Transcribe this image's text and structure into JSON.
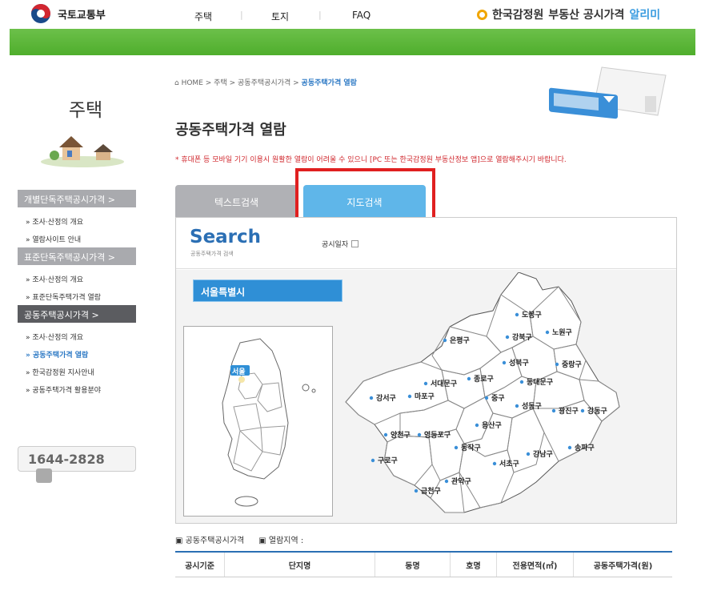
{
  "header": {
    "logo_text": "국토교통부",
    "nav": [
      "주택",
      "토지",
      "FAQ"
    ],
    "brand": "한국감정원",
    "brand_suffix": "부동산 공시가격",
    "brand_accent": "알리미"
  },
  "sidebar": {
    "title": "주택",
    "sections": [
      {
        "label": "개별단독주택공시가격 >",
        "items": [
          "» 조사·산정의 개요",
          "» 열람사이트 안내"
        ]
      },
      {
        "label": "표준단독주택공시가격 >",
        "items": [
          "» 조사·산정의 개요",
          "» 표준단독주택가격 열람"
        ]
      },
      {
        "label": "공동주택공시가격 >",
        "items": [
          "» 조사·산정의 개요",
          "» 공동주택가격 열람",
          "» 한국감정원 지사안내",
          "» 공동주택가격 활용분야"
        ]
      }
    ],
    "phone": "1644-2828"
  },
  "breadcrumb": [
    "HOME",
    "주택",
    "공동주택공시가격",
    "공동주택가격 열람"
  ],
  "page_title": "공동주택가격 열람",
  "notice": "* 휴대폰 등 모바일 기기 이용시 원활한 열람이 어려울 수 있으니 [PC 또는 한국감정원 부동산정보 앱]으로 열람해주시기 바랍니다.",
  "tabs": [
    "텍스트검색",
    "지도검색"
  ],
  "search": {
    "title": "Search",
    "subtitle": "공동주택가격 검색",
    "date_label": "공시일자"
  },
  "map": {
    "city": "서울특별시",
    "korea_label": "서울",
    "districts": [
      "도봉구",
      "노원구",
      "강북구",
      "은평구",
      "성북구",
      "중랑구",
      "종로구",
      "동대문구",
      "서대문구",
      "강서구",
      "마포구",
      "중구",
      "성동구",
      "광진구",
      "강동구",
      "용산구",
      "양천구",
      "영등포구",
      "동작구",
      "강남구",
      "송파구",
      "구로구",
      "서초구",
      "금천구",
      "관악구"
    ]
  },
  "footer_links": [
    "공동주택공시가격",
    "열람지역 :"
  ],
  "table": {
    "columns": [
      "공시기준",
      "단지명",
      "동명",
      "호명",
      "전용면적(㎡)",
      "공동주택가격(원)"
    ]
  }
}
